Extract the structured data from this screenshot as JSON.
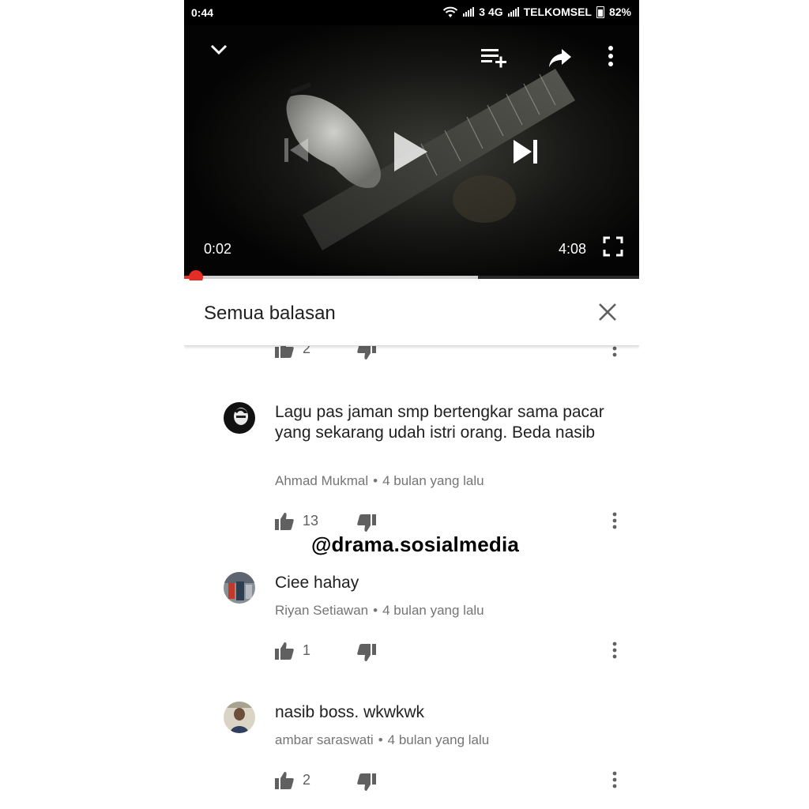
{
  "status_bar": {
    "time": "0:44",
    "network": "3 4G",
    "carrier": "TELKOMSEL",
    "battery": "82%"
  },
  "player": {
    "current_time": "0:02",
    "duration": "4:08",
    "played_fraction": 0.01,
    "buffered_fraction": 0.645,
    "icons": [
      "chevron-down-icon",
      "add-to-queue-icon",
      "share-icon",
      "more-vert-icon",
      "skip-previous-icon",
      "play-icon",
      "skip-next-icon",
      "fullscreen-icon"
    ]
  },
  "replies_panel": {
    "title": "Semua balasan"
  },
  "top_actions": {
    "like_count": "2"
  },
  "comments": [
    {
      "author": "Ahmad Mukmal",
      "time": "4 bulan yang lalu",
      "text": "Lagu pas jaman smp bertengkar sama pacar yang sekarang udah istri orang. Beda nasib",
      "like_count": "13"
    },
    {
      "author": "Riyan Setiawan",
      "time": "4 bulan yang lalu",
      "text": "Ciee hahay",
      "like_count": "1"
    },
    {
      "author": "ambar saraswati",
      "time": "4 bulan yang lalu",
      "text": "nasib boss. wkwkwk",
      "like_count": "2"
    }
  ],
  "meta_separator": "•",
  "watermark": "@drama.sosialmedia",
  "colors": {
    "accent_red": "#e52d27",
    "text_primary": "#212121",
    "text_secondary": "#757575",
    "icon_gray": "#606060"
  }
}
